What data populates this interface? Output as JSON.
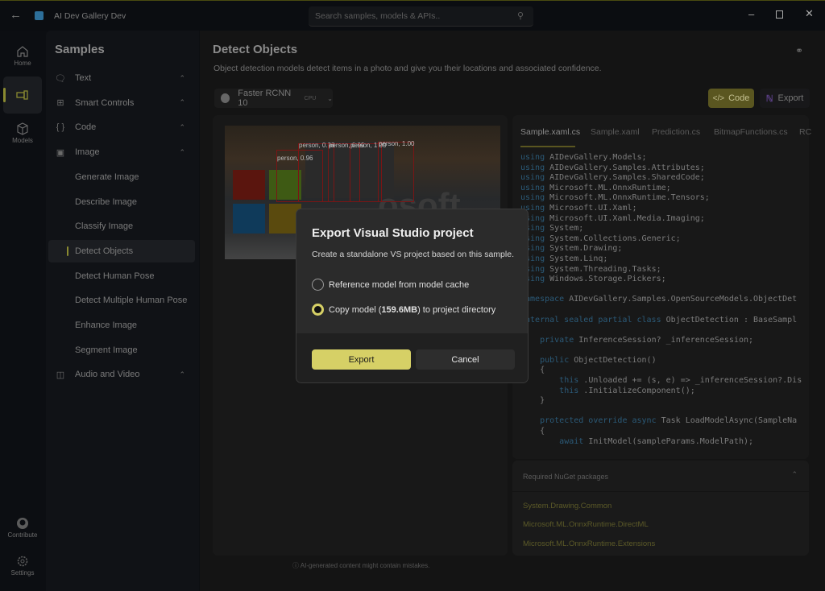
{
  "titlebar": {
    "app_title": "AI Dev Gallery Dev",
    "search_placeholder": "Search samples, models & APIs.."
  },
  "rail": {
    "home": "Home",
    "models": "Models",
    "contribute": "Contribute",
    "settings": "Settings"
  },
  "samples": {
    "title": "Samples",
    "items": [
      {
        "label": "Text",
        "icon": "chat-icon",
        "expandable": true
      },
      {
        "label": "Smart Controls",
        "icon": "grid-icon",
        "expandable": true
      },
      {
        "label": "Code",
        "icon": "braces-icon",
        "expandable": true
      },
      {
        "label": "Image",
        "icon": "image-icon",
        "expandable": true,
        "expanded": true
      },
      {
        "label": "Generate Image",
        "sub": true
      },
      {
        "label": "Describe Image",
        "sub": true
      },
      {
        "label": "Classify Image",
        "sub": true
      },
      {
        "label": "Detect Objects",
        "sub": true,
        "selected": true
      },
      {
        "label": "Detect Human Pose",
        "sub": true
      },
      {
        "label": "Detect Multiple Human Pose",
        "sub": true
      },
      {
        "label": "Enhance Image",
        "sub": true
      },
      {
        "label": "Segment Image",
        "sub": true
      },
      {
        "label": "Audio and Video",
        "icon": "media-icon",
        "expandable": true
      }
    ]
  },
  "page": {
    "title": "Detect Objects",
    "description": "Object detection models detect items in a photo and give you their locations and associated confidence.",
    "model_name": "Faster RCNN 10",
    "model_badge": "CPU",
    "code_button": "Code",
    "export_button": "Export",
    "detections": [
      "person, 0.96",
      "person, 0.98",
      "person, 0.99",
      "person, 1.00",
      "person, 1.00"
    ],
    "footer_note": "AI-generated content might contain mistakes."
  },
  "code_tabs": [
    "Sample.xaml.cs",
    "Sample.xaml",
    "Prediction.cs",
    "BitmapFunctions.cs",
    "RC"
  ],
  "code_lines": [
    [
      [
        "kw",
        "using"
      ],
      [
        "",
        "AIDevGallery.Models;"
      ]
    ],
    [
      [
        "kw",
        "using"
      ],
      [
        "",
        "AIDevGallery.Samples.Attributes;"
      ]
    ],
    [
      [
        "kw",
        "using"
      ],
      [
        "",
        "AIDevGallery.Samples.SharedCode;"
      ]
    ],
    [
      [
        "kw",
        "using"
      ],
      [
        "",
        "Microsoft.ML.OnnxRuntime;"
      ]
    ],
    [
      [
        "kw",
        "using"
      ],
      [
        "",
        "Microsoft.ML.OnnxRuntime.Tensors;"
      ]
    ],
    [
      [
        "kw",
        "using"
      ],
      [
        "",
        "Microsoft.UI.Xaml;"
      ]
    ],
    [
      [
        "kw",
        "using"
      ],
      [
        "",
        "Microsoft.UI.Xaml.Media.Imaging;"
      ]
    ],
    [
      [
        "kw",
        "using"
      ],
      [
        "",
        "System;"
      ]
    ],
    [
      [
        "kw",
        "using"
      ],
      [
        "",
        "System.Collections.Generic;"
      ]
    ],
    [
      [
        "kw",
        "using"
      ],
      [
        "",
        "System.Drawing;"
      ]
    ],
    [
      [
        "kw",
        "using"
      ],
      [
        "",
        "System.Linq;"
      ]
    ],
    [
      [
        "kw",
        "using"
      ],
      [
        "",
        "System.Threading.Tasks;"
      ]
    ],
    [
      [
        "kw",
        "using"
      ],
      [
        "",
        "Windows.Storage.Pickers;"
      ]
    ],
    [],
    [
      [
        "kw",
        "namespace"
      ],
      [
        "",
        "AIDevGallery.Samples.OpenSourceModels.ObjectDet"
      ]
    ],
    [],
    [
      [
        "kw",
        "internal sealed partial class"
      ],
      [
        "",
        "ObjectDetection : BaseSampl"
      ]
    ],
    [],
    [
      [
        "",
        "    "
      ],
      [
        "kw",
        "private"
      ],
      [
        "",
        "InferenceSession? _inferenceSession;"
      ]
    ],
    [],
    [
      [
        "",
        "    "
      ],
      [
        "kw",
        "public"
      ],
      [
        "",
        "ObjectDetection()"
      ]
    ],
    [
      [
        "",
        "    {"
      ]
    ],
    [
      [
        "",
        "        "
      ],
      [
        "kw",
        "this"
      ],
      [
        "",
        ".Unloaded += (s, e) => _inferenceSession?.Dis"
      ]
    ],
    [
      [
        "",
        "        "
      ],
      [
        "kw",
        "this"
      ],
      [
        "",
        ".InitializeComponent();"
      ]
    ],
    [
      [
        "",
        "    }"
      ]
    ],
    [],
    [
      [
        "",
        "    "
      ],
      [
        "kw",
        "protected override async"
      ],
      [
        "",
        "Task LoadModelAsync(SampleNa"
      ]
    ],
    [
      [
        "",
        "    {"
      ]
    ],
    [
      [
        "",
        "        "
      ],
      [
        "kw",
        "await"
      ],
      [
        "",
        "InitModel(sampleParams.ModelPath);"
      ]
    ]
  ],
  "nuget": {
    "title": "Required NuGet packages",
    "packages": [
      "System.Drawing.Common",
      "Microsoft.ML.OnnxRuntime.DirectML",
      "Microsoft.ML.OnnxRuntime.Extensions"
    ]
  },
  "dialog": {
    "title": "Export Visual Studio project",
    "description": "Create a standalone VS project based on this sample.",
    "options": [
      {
        "label": "Reference model from model cache",
        "selected": false
      },
      {
        "label_prefix": "Copy model (",
        "label_bold": "159.6MB",
        "label_suffix": ") to project directory",
        "selected": true
      }
    ],
    "primary": "Export",
    "secondary": "Cancel"
  },
  "colors": {
    "accent": "#d6d066",
    "keyword": "#2b5a78",
    "nuget_link": "#5c5a28"
  }
}
